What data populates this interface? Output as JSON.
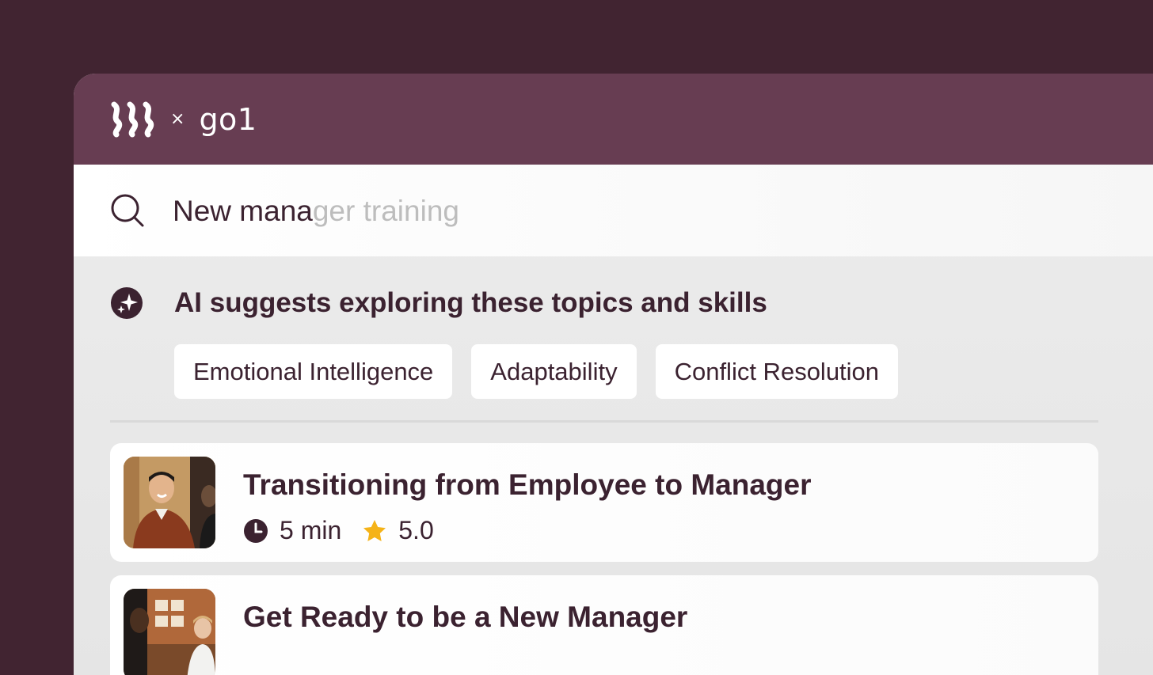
{
  "brand": {
    "separator": "×",
    "partner_name": "go1"
  },
  "search": {
    "typed_text": "New mana",
    "autocomplete_text": "ger training"
  },
  "suggestions": {
    "title": "AI suggests exploring these topics and skills",
    "chips": [
      "Emotional Intelligence",
      "Adaptability",
      "Conflict Resolution"
    ]
  },
  "results": [
    {
      "title": "Transitioning from Employee to Manager",
      "duration": "5 min",
      "rating": "5.0"
    },
    {
      "title": "Get Ready to be a New Manager"
    }
  ],
  "colors": {
    "background": "#412431",
    "header": "#673d52",
    "text": "#3b2230",
    "star": "#f5b318"
  },
  "icons": [
    "brand-logo-icon",
    "search-icon",
    "ai-sparkle-icon",
    "clock-icon",
    "star-icon"
  ]
}
